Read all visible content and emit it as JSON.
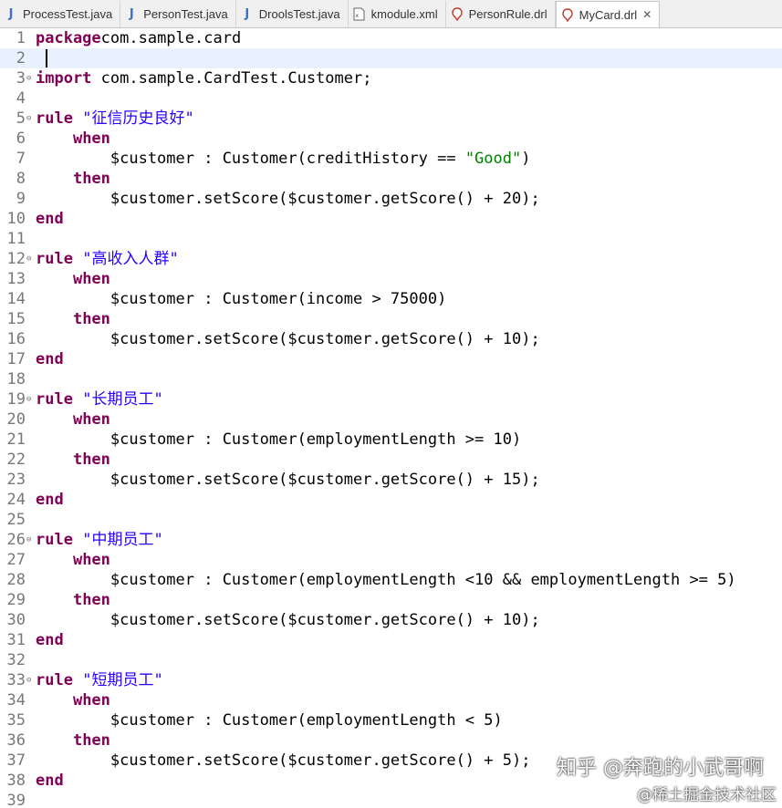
{
  "tabs": [
    {
      "label": "ProcessTest.java",
      "icon": "java-file-icon"
    },
    {
      "label": "PersonTest.java",
      "icon": "java-file-icon"
    },
    {
      "label": "DroolsTest.java",
      "icon": "java-file-icon"
    },
    {
      "label": "kmodule.xml",
      "icon": "xml-file-icon"
    },
    {
      "label": "PersonRule.drl",
      "icon": "drools-file-icon"
    },
    {
      "label": "MyCard.drl",
      "icon": "drools-file-icon",
      "active": true
    }
  ],
  "colors": {
    "keyword": "#7f0055",
    "string": "#2a00ff",
    "line_number": "#787878",
    "current_line": "#e8f2fe"
  },
  "current_line": 2,
  "lines": [
    {
      "n": "1",
      "parts": [
        [
          "kw",
          "package"
        ],
        [
          "",
          "com.sample.card"
        ]
      ]
    },
    {
      "n": "2",
      "parts": []
    },
    {
      "n": "3",
      "parts": [
        [
          "kw",
          "import"
        ],
        [
          "",
          " com.sample.CardTest.Customer;"
        ]
      ]
    },
    {
      "n": "4",
      "parts": []
    },
    {
      "n": "5",
      "parts": [
        [
          "kw",
          "rule"
        ],
        [
          "",
          " "
        ],
        [
          "str",
          "\"征信历史良好\""
        ]
      ]
    },
    {
      "n": "6",
      "parts": [
        [
          "",
          "    "
        ],
        [
          "kw",
          "when"
        ]
      ]
    },
    {
      "n": "7",
      "parts": [
        [
          "",
          "        $customer : Customer(creditHistory == "
        ],
        [
          "strg",
          "\"Good\""
        ],
        [
          "",
          ")"
        ]
      ]
    },
    {
      "n": "8",
      "parts": [
        [
          "",
          "    "
        ],
        [
          "kw",
          "then"
        ]
      ]
    },
    {
      "n": "9",
      "parts": [
        [
          "",
          "        $customer.setScore($customer.getScore() + 20);"
        ]
      ]
    },
    {
      "n": "10",
      "parts": [
        [
          "kw",
          "end"
        ]
      ]
    },
    {
      "n": "11",
      "parts": []
    },
    {
      "n": "12",
      "parts": [
        [
          "kw",
          "rule"
        ],
        [
          "",
          " "
        ],
        [
          "str",
          "\"高收入人群\""
        ]
      ]
    },
    {
      "n": "13",
      "parts": [
        [
          "",
          "    "
        ],
        [
          "kw",
          "when"
        ]
      ]
    },
    {
      "n": "14",
      "parts": [
        [
          "",
          "        $customer : Customer(income > 75000)"
        ]
      ]
    },
    {
      "n": "15",
      "parts": [
        [
          "",
          "    "
        ],
        [
          "kw",
          "then"
        ]
      ]
    },
    {
      "n": "16",
      "parts": [
        [
          "",
          "        $customer.setScore($customer.getScore() + 10);"
        ]
      ]
    },
    {
      "n": "17",
      "parts": [
        [
          "kw",
          "end"
        ]
      ]
    },
    {
      "n": "18",
      "parts": []
    },
    {
      "n": "19",
      "parts": [
        [
          "kw",
          "rule"
        ],
        [
          "",
          " "
        ],
        [
          "str",
          "\"长期员工\""
        ]
      ]
    },
    {
      "n": "20",
      "parts": [
        [
          "",
          "    "
        ],
        [
          "kw",
          "when"
        ]
      ]
    },
    {
      "n": "21",
      "parts": [
        [
          "",
          "        $customer : Customer(employmentLength >= 10)"
        ]
      ]
    },
    {
      "n": "22",
      "parts": [
        [
          "",
          "    "
        ],
        [
          "kw",
          "then"
        ]
      ]
    },
    {
      "n": "23",
      "parts": [
        [
          "",
          "        $customer.setScore($customer.getScore() + 15);"
        ]
      ]
    },
    {
      "n": "24",
      "parts": [
        [
          "kw",
          "end"
        ]
      ]
    },
    {
      "n": "25",
      "parts": []
    },
    {
      "n": "26",
      "parts": [
        [
          "kw",
          "rule"
        ],
        [
          "",
          " "
        ],
        [
          "str",
          "\"中期员工\""
        ]
      ]
    },
    {
      "n": "27",
      "parts": [
        [
          "",
          "    "
        ],
        [
          "kw",
          "when"
        ]
      ]
    },
    {
      "n": "28",
      "parts": [
        [
          "",
          "        $customer : Customer(employmentLength <10 && employmentLength >= 5)"
        ]
      ]
    },
    {
      "n": "29",
      "parts": [
        [
          "",
          "    "
        ],
        [
          "kw",
          "then"
        ]
      ]
    },
    {
      "n": "30",
      "parts": [
        [
          "",
          "        $customer.setScore($customer.getScore() + 10);"
        ]
      ]
    },
    {
      "n": "31",
      "parts": [
        [
          "kw",
          "end"
        ]
      ]
    },
    {
      "n": "32",
      "parts": []
    },
    {
      "n": "33",
      "parts": [
        [
          "kw",
          "rule"
        ],
        [
          "",
          " "
        ],
        [
          "str",
          "\"短期员工\""
        ]
      ]
    },
    {
      "n": "34",
      "parts": [
        [
          "",
          "    "
        ],
        [
          "kw",
          "when"
        ]
      ]
    },
    {
      "n": "35",
      "parts": [
        [
          "",
          "        $customer : Customer(employmentLength < 5)"
        ]
      ]
    },
    {
      "n": "36",
      "parts": [
        [
          "",
          "    "
        ],
        [
          "kw",
          "then"
        ]
      ]
    },
    {
      "n": "37",
      "parts": [
        [
          "",
          "        $customer.setScore($customer.getScore() + 5);"
        ]
      ]
    },
    {
      "n": "38",
      "parts": [
        [
          "kw",
          "end"
        ]
      ]
    },
    {
      "n": "39",
      "parts": []
    }
  ],
  "watermark": {
    "line1": "知乎 @奔跑的小武哥啊",
    "line2": "@稀土掘金技术社区"
  }
}
